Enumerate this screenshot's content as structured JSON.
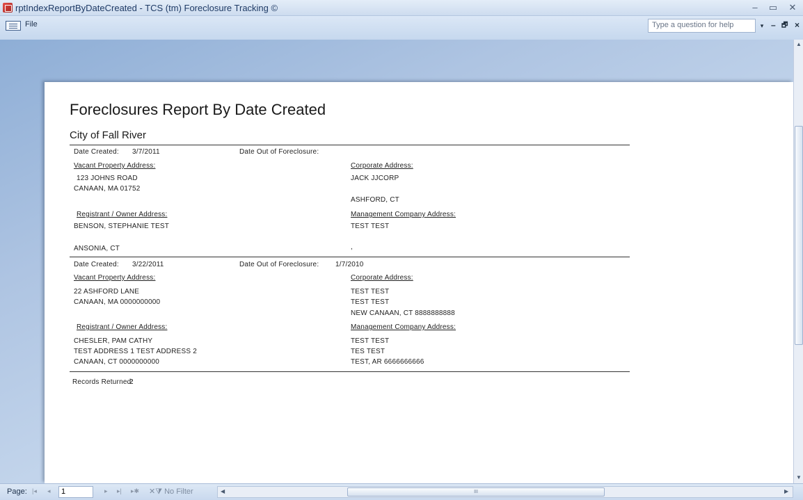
{
  "window": {
    "title": "rptIndexReportByDateCreated - TCS (tm) Foreclosure Tracking ©",
    "minimize": "–",
    "restore": "▭",
    "close": "✕"
  },
  "menu": {
    "file_label": "File",
    "help_placeholder": "Type a question for help",
    "help_dropdown": "▾",
    "mdi_minimize": "–",
    "mdi_restore": "🗗",
    "mdi_close": "×"
  },
  "report": {
    "title": "Foreclosures Report By Date Created",
    "subtitle": "City of Fall River",
    "date_created_label": "Date Created:",
    "date_out_label": "Date Out of Foreclosure:",
    "vacant_label": "Vacant Property Address:",
    "corporate_label": "Corporate Address:",
    "registrant_label": "Registrant / Owner Address:",
    "management_label": "Management Company Address:",
    "records": [
      {
        "date_created": "3/7/2011",
        "date_out": "",
        "vacant": [
          "123 JOHNS ROAD",
          "CANAAN, MA 01752"
        ],
        "corporate": [
          "JACK JJCORP",
          "",
          "ASHFORD, CT"
        ],
        "registrant": [
          "BENSON, STEPHANIE TEST",
          "",
          "ANSONIA, CT"
        ],
        "management": [
          "TEST TEST",
          "",
          ","
        ]
      },
      {
        "date_created": "3/22/2011",
        "date_out": "1/7/2010",
        "vacant": [
          "22 ASHFORD LANE",
          "CANAAN, MA 0000000000"
        ],
        "corporate": [
          "TEST TEST",
          "TEST TEST",
          "NEW CANAAN, CT 8888888888"
        ],
        "registrant": [
          "CHESLER, PAM CATHY",
          "TEST ADDRESS 1 TEST ADDRESS 2",
          "CANAAN, CT 0000000000"
        ],
        "management": [
          "TEST TEST",
          "TES TEST",
          "TEST, AR 6666666666"
        ]
      }
    ],
    "records_returned_label": "Records Returned:",
    "records_returned": "2"
  },
  "statusbar": {
    "page_label": "Page:",
    "page_value": "1",
    "nav_first": "|◂",
    "nav_prev": "◂",
    "nav_next": "▸",
    "nav_last": "▸|",
    "nav_new": "▸✱",
    "filter_label": "No Filter",
    "filter_icon": "✕⧩",
    "scroll_left": "◀",
    "scroll_right": "▶",
    "grip": "III"
  },
  "colors": {
    "titlebar": "#dbe7f6",
    "background": "#b8cde6",
    "page": "#ffffff"
  }
}
